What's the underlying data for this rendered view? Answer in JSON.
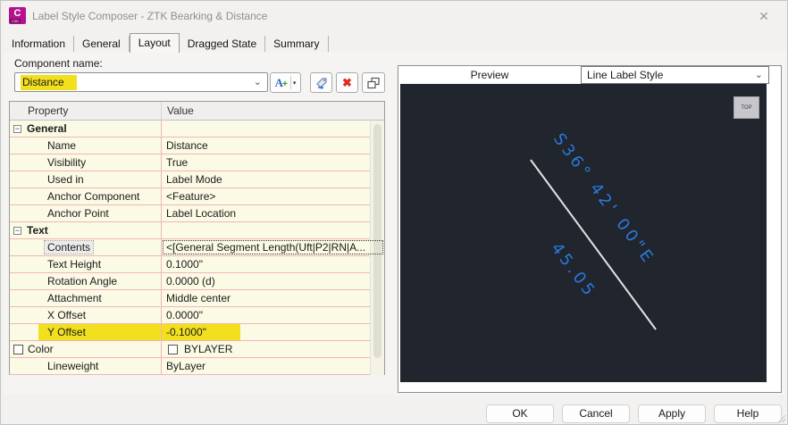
{
  "window": {
    "title": "Label Style Composer - ZTK Bearking & Distance",
    "close_icon": "✕",
    "app_icon": {
      "letter": "C",
      "sub": "C3D"
    }
  },
  "tabs": [
    {
      "label": "Information",
      "active": false
    },
    {
      "label": "General",
      "active": false
    },
    {
      "label": "Layout",
      "active": true
    },
    {
      "label": "Dragged State",
      "active": false
    },
    {
      "label": "Summary",
      "active": false
    }
  ],
  "component": {
    "label": "Component name:",
    "value": "Distance"
  },
  "toolbar": {
    "add_text_letter": "A",
    "add_text_plus": "+",
    "dropdown_arrow": "▾",
    "delete_glyph": "✖"
  },
  "icons": {
    "collapse_glyph": "−",
    "combo_chevron": "⌄",
    "viewcube_label": "TOP"
  },
  "grid": {
    "columns": [
      "Property",
      "Value"
    ],
    "rows": [
      {
        "property": "General",
        "value": "",
        "type": "section"
      },
      {
        "property": "Name",
        "value": "Distance"
      },
      {
        "property": "Visibility",
        "value": "True"
      },
      {
        "property": "Used in",
        "value": "Label Mode"
      },
      {
        "property": "Anchor Component",
        "value": "<Feature>"
      },
      {
        "property": "Anchor Point",
        "value": "Label Location"
      },
      {
        "property": "Text",
        "value": "",
        "type": "section"
      },
      {
        "property": "Contents",
        "value": "<[General Segment Length(Uft|P2|RN|A..."
      },
      {
        "property": "Text Height",
        "value": "0.1000\""
      },
      {
        "property": "Rotation Angle",
        "value": "0.0000 (d)"
      },
      {
        "property": "Attachment",
        "value": "Middle center"
      },
      {
        "property": "X Offset",
        "value": "0.0000\""
      },
      {
        "property": "Y Offset",
        "value": "-0.1000\"",
        "highlighted": true
      },
      {
        "property": "Color",
        "value": "BYLAYER",
        "swatch": true
      },
      {
        "property": "Lineweight",
        "value": "ByLayer"
      }
    ]
  },
  "preview": {
    "header": "Preview",
    "style_selector": "Line Label Style",
    "bearing_text": "S36° 42' 00\"E",
    "distance_text": "45.05"
  },
  "colors": {
    "highlight_yellow": "#f2e01e",
    "label_blue": "#2b78dc",
    "canvas_bg": "#21262e",
    "app_magenta": "#b5128f",
    "grid_row_bg": "#fbfae5",
    "grid_border_pink": "#f0b6b8"
  },
  "footer": {
    "ok": "OK",
    "cancel": "Cancel",
    "apply": "Apply",
    "help": "Help"
  }
}
